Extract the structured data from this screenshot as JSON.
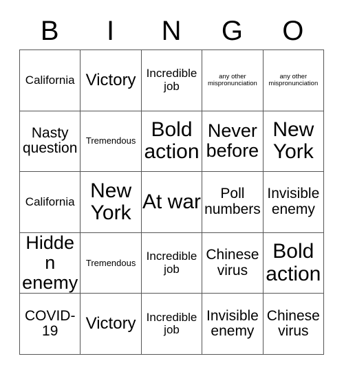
{
  "card": {
    "header_letters": [
      "B",
      "I",
      "N",
      "G",
      "O"
    ],
    "rows": [
      [
        {
          "text": "California",
          "size": "sm"
        },
        {
          "text": "Victory",
          "size": "lg"
        },
        {
          "text": "Incredible job",
          "size": "sm"
        },
        {
          "text": "any other mispronunciation",
          "size": "tiny"
        },
        {
          "text": "any other mispronunciation",
          "size": "tiny"
        }
      ],
      [
        {
          "text": "Nasty question",
          "size": "md"
        },
        {
          "text": "Tremendous",
          "size": "xxs"
        },
        {
          "text": "Bold action",
          "size": "xxl"
        },
        {
          "text": "Never before",
          "size": "xl"
        },
        {
          "text": "New York",
          "size": "xxl"
        }
      ],
      [
        {
          "text": "California",
          "size": "sm"
        },
        {
          "text": "New York",
          "size": "xxl"
        },
        {
          "text": "At war",
          "size": "xxl"
        },
        {
          "text": "Poll numbers",
          "size": "md"
        },
        {
          "text": "Invisible enemy",
          "size": "md"
        }
      ],
      [
        {
          "text": "Hidden enemy",
          "size": "xl"
        },
        {
          "text": "Tremendous",
          "size": "xxs"
        },
        {
          "text": "Incredible job",
          "size": "sm"
        },
        {
          "text": "Chinese virus",
          "size": "md"
        },
        {
          "text": "Bold action",
          "size": "xxl"
        }
      ],
      [
        {
          "text": "COVID-19",
          "size": "md"
        },
        {
          "text": "Victory",
          "size": "lg"
        },
        {
          "text": "Incredible job",
          "size": "sm"
        },
        {
          "text": "Invisible enemy",
          "size": "md"
        },
        {
          "text": "Chinese virus",
          "size": "md"
        }
      ]
    ]
  },
  "colors": {
    "background": "#ffffff",
    "text": "#000000",
    "grid_line": "#555555"
  }
}
